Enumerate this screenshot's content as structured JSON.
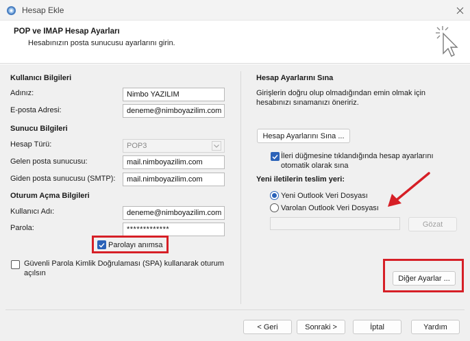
{
  "window": {
    "title": "Hesap Ekle"
  },
  "header": {
    "title": "POP ve IMAP Hesap Ayarları",
    "subtitle": "Hesabınızın posta sunucusu ayarlarını girin."
  },
  "user_info": {
    "section": "Kullanıcı Bilgileri",
    "name_label": "Adınız:",
    "name_value": "Nimbo YAZILIM",
    "email_label": "E-posta Adresi:",
    "email_value": "deneme@nimboyazilim.com"
  },
  "server_info": {
    "section": "Sunucu Bilgileri",
    "account_type_label": "Hesap Türü:",
    "account_type_value": "POP3",
    "incoming_label": "Gelen posta sunucusu:",
    "incoming_value": "mail.nimboyazilim.com",
    "outgoing_label": "Giden posta sunucusu (SMTP):",
    "outgoing_value": "mail.nimboyazilim.com"
  },
  "logon_info": {
    "section": "Oturum Açma Bilgileri",
    "username_label": "Kullanıcı Adı:",
    "username_value": "deneme@nimboyazilim.com",
    "password_label": "Parola:",
    "password_value": "*************",
    "remember_label": "Parolayı anımsa",
    "remember_checked": true,
    "spa_label_line1": "Güvenli Parola Kimlik Doğrulaması (SPA) kullanarak oturum",
    "spa_label_line2": "açılsın",
    "spa_checked": false
  },
  "test": {
    "section": "Hesap Ayarlarını Sına",
    "desc_line1": "Girişlerin doğru olup olmadığından emin olmak için",
    "desc_line2": "hesabınızı sınamanızı öneririz.",
    "test_button": "Hesap Ayarlarını Sına ...",
    "auto_test_line1": "İleri düğmesine tıklandığında hesap ayarlarını",
    "auto_test_line2": "otomatik olarak sına",
    "auto_test_checked": true
  },
  "delivery": {
    "section": "Yeni iletilerin teslim yeri:",
    "option_new": "Yeni Outlook Veri Dosyası",
    "option_existing": "Varolan Outlook Veri Dosyası",
    "selected": "new",
    "file_path": "",
    "browse_button": "Gözat"
  },
  "more_settings_button": "Diğer Ayarlar ...",
  "footer": {
    "back": "< Geri",
    "next": "Sonraki >",
    "cancel": "İptal",
    "help": "Yardım"
  },
  "colors": {
    "accent": "#2b62b8",
    "highlight_red": "#d61f26"
  }
}
